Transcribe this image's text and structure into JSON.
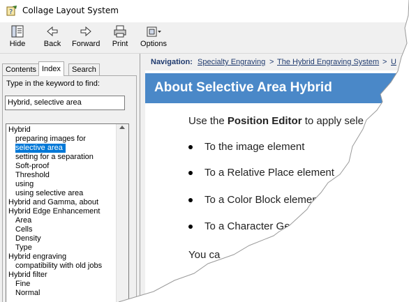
{
  "window": {
    "title": "Collage Layout System"
  },
  "toolbar": {
    "hide": "Hide",
    "back": "Back",
    "forward": "Forward",
    "print": "Print",
    "options": "Options"
  },
  "tabs": {
    "contents": "Contents",
    "index": "Index",
    "search": "Search"
  },
  "index_panel": {
    "prompt": "Type in the keyword to find:",
    "keyword_value": "Hybrid, selective area",
    "items": [
      "Hybrid",
      "preparing images for",
      "selective area",
      "setting for a separation",
      "Soft-proof",
      "Threshold",
      "using",
      "using selective area",
      "Hybrid and Gamma, about",
      "Hybrid Edge Enhancement",
      "Area",
      "Cells",
      "Density",
      "Type",
      "Hybrid engraving",
      "compatibility with old jobs",
      "Hybrid filter",
      "Fine",
      "Normal"
    ]
  },
  "navigation": {
    "label": "Navigation:",
    "crumbs": [
      "Specialty Engraving",
      "The Hybrid Engraving System",
      "U"
    ],
    "separator": ">"
  },
  "page": {
    "heading": "About Selective Area Hybrid",
    "intro_pre": "Use the ",
    "intro_bold": "Position Editor",
    "intro_post": " to apply sele",
    "bullets": [
      "To the image element",
      "To a Relative Place element",
      "To a Color Block element",
      "To a Character Ge"
    ],
    "trailing": "You ca"
  },
  "colors": {
    "heading_bg": "#4a88c8",
    "selection": "#0078d7",
    "link": "#1f3a6e"
  }
}
